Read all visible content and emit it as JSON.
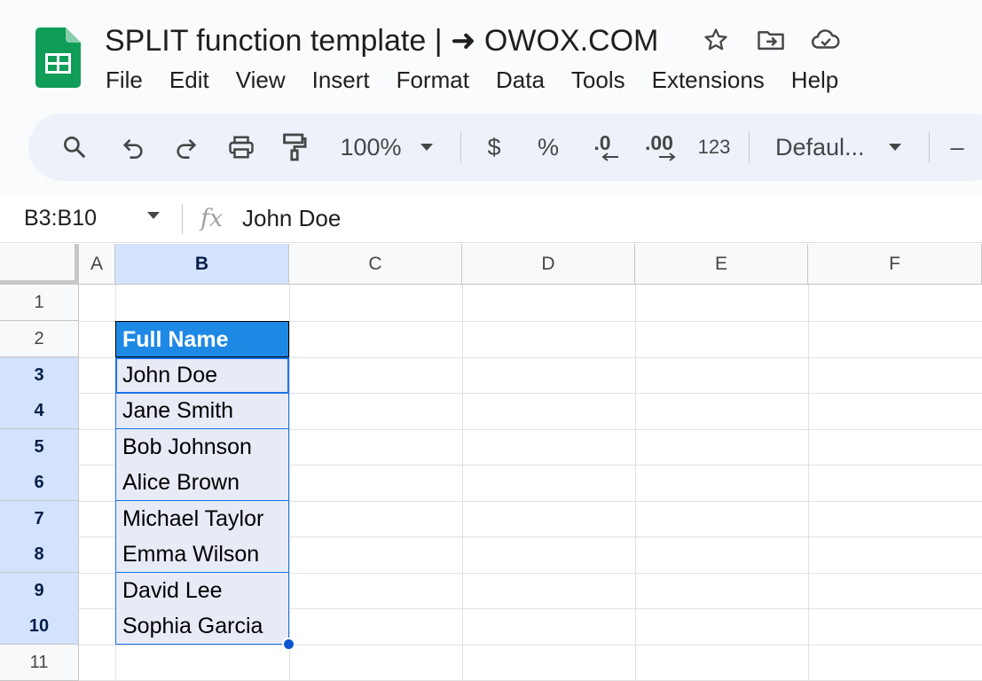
{
  "document": {
    "title": "SPLIT function template | ➜ OWOX.COM"
  },
  "menu": [
    "File",
    "Edit",
    "View",
    "Insert",
    "Format",
    "Data",
    "Tools",
    "Extensions",
    "Help"
  ],
  "toolbar": {
    "zoom": "100%",
    "currency": "$",
    "percent": "%",
    "decrease_decimal": ".0",
    "increase_decimal": ".00",
    "number_format": "123",
    "font": "Defaul...",
    "minus": "–"
  },
  "formula_bar": {
    "name_box": "B3:B10",
    "fx": "fx",
    "value": "John Doe"
  },
  "grid": {
    "columns": [
      "A",
      "B",
      "C",
      "D",
      "E",
      "F"
    ],
    "rows": [
      "1",
      "2",
      "3",
      "4",
      "5",
      "6",
      "7",
      "8",
      "9",
      "10",
      "11"
    ],
    "column_b": {
      "header": "Full Name",
      "names": [
        "John Doe",
        "Jane Smith",
        "Bob Johnson",
        "Alice Brown",
        "Michael Taylor",
        "Emma Wilson",
        "David Lee",
        "Sophia Garcia"
      ]
    }
  },
  "colors": {
    "header_fill": "#1e88e5",
    "selection_fill": "#e8eaf6",
    "selection_border": "#1a73e8",
    "sheets_green": "#0f9d58"
  }
}
